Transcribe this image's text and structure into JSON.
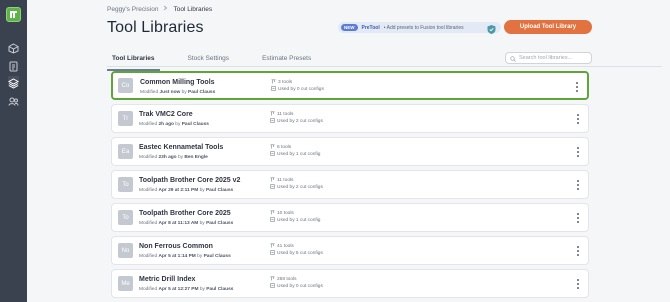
{
  "breadcrumb": {
    "root": "Peggy's Precision",
    "current": "Tool Libraries"
  },
  "page_title": "Tool Libraries",
  "promo": {
    "badge": "NEW",
    "product": "PreTool",
    "text": "• Add presets to Fusion tool libraries"
  },
  "upload_label": "Upload Tool Library",
  "tabs": [
    {
      "label": "Tool Libraries",
      "active": true
    },
    {
      "label": "Stock Settings",
      "active": false
    },
    {
      "label": "Estimate Presets",
      "active": false
    }
  ],
  "search": {
    "placeholder": "Search tool libraries...",
    "value": ""
  },
  "libraries": [
    {
      "initials": "Co",
      "name": "Common Milling Tools",
      "modified_prefix": "Modified",
      "modified_when": "Just now",
      "modified_by": "Paul Clauss",
      "tools": "3 tools",
      "configs": "Used by 0 cut configs",
      "selected": true
    },
    {
      "initials": "Tr",
      "name": "Trak VMC2 Core",
      "modified_prefix": "Modified",
      "modified_when": "2h ago",
      "modified_by": "Paul Clauss",
      "tools": "11 tools",
      "configs": "Used by 2 cut configs",
      "selected": false
    },
    {
      "initials": "Ea",
      "name": "Eastec Kennametal Tools",
      "modified_prefix": "Modified",
      "modified_when": "23h ago",
      "modified_by": "Ben Engle",
      "tools": "6 tools",
      "configs": "Used by 1 cut config",
      "selected": false
    },
    {
      "initials": "To",
      "name": "Toolpath Brother Core 2025 v2",
      "modified_prefix": "Modified",
      "modified_when": "Apr 29 at 2:11 PM",
      "modified_by": "Paul Clauss",
      "tools": "11 tools",
      "configs": "Used by 2 cut configs",
      "selected": false
    },
    {
      "initials": "To",
      "name": "Toolpath Brother Core 2025",
      "modified_prefix": "Modified",
      "modified_when": "Apr 8 at 11:13 AM",
      "modified_by": "Paul Clauss",
      "tools": "10 tools",
      "configs": "Used by 1 cut config",
      "selected": false
    },
    {
      "initials": "No",
      "name": "Non Ferrous Common",
      "modified_prefix": "Modified",
      "modified_when": "Apr 5 at 1:14 PM",
      "modified_by": "Paul Clauss",
      "tools": "41 tools",
      "configs": "Used by 5 cut configs",
      "selected": false
    },
    {
      "initials": "Me",
      "name": "Metric Drill Index",
      "modified_prefix": "Modified",
      "modified_when": "Apr 5 at 12:27 PM",
      "modified_by": "Paul Clauss",
      "tools": "258 tools",
      "configs": "Used by 0 cut configs",
      "selected": false
    }
  ],
  "colors": {
    "accent": "#e2723f",
    "selected_border": "#5fa53a",
    "rail": "#3a4250"
  },
  "icons": {
    "rail": [
      "logo-icon",
      "cube-icon",
      "document-icon",
      "layers-icon",
      "users-icon"
    ]
  }
}
